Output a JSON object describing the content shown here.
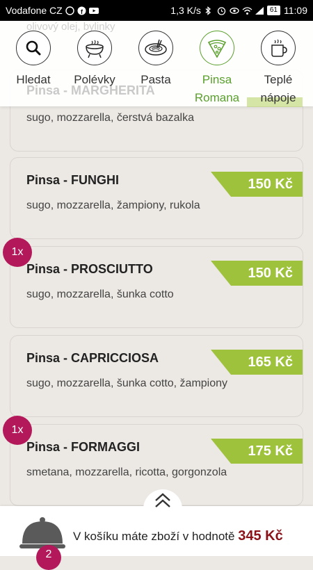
{
  "status_bar": {
    "carrier": "Vodafone CZ",
    "net_speed": "1,3 K/s",
    "battery": "61",
    "time": "11:09"
  },
  "categories_bar": {
    "behind_text": "olivový olej, bylinky",
    "behind_title": "Pinsa - MARGHERITA",
    "categories": [
      {
        "line1": "Hledat",
        "line2": "",
        "icon": "search-icon"
      },
      {
        "line1": "Polévky",
        "line2": "",
        "icon": "soup-pot-icon"
      },
      {
        "line1": "Pasta",
        "line2": "",
        "icon": "pasta-plate-icon"
      },
      {
        "line1": "Pinsa",
        "line2": "Romana",
        "icon": "pizza-slice-icon",
        "active": true
      },
      {
        "line1": "Teplé",
        "line2": "nápoje",
        "icon": "hot-drink-icon"
      }
    ]
  },
  "menu": {
    "items": [
      {
        "name": "",
        "desc": "sugo, mozzarella, čerstvá bazalka",
        "price": "",
        "qty": ""
      },
      {
        "name": "Pinsa - FUNGHI",
        "desc": "sugo, mozzarella, žampiony, rukola",
        "price": "150 Kč",
        "qty": ""
      },
      {
        "name": "Pinsa - PROSCIUTTO",
        "desc": "sugo, mozzarella, šunka cotto",
        "price": "150 Kč",
        "qty": "1x"
      },
      {
        "name": "Pinsa - CAPRICCIOSA",
        "desc": "sugo, mozzarella, šunka cotto, žampiony",
        "price": "165 Kč",
        "qty": ""
      },
      {
        "name": "Pinsa - FORMAGGI",
        "desc": "smetana, mozzarella, ricotta, gorgonzola",
        "price": "175 Kč",
        "qty": "1x"
      }
    ]
  },
  "cart": {
    "text": "V košíku máte zboží v hodnotě",
    "total": "345 Kč",
    "count": "2"
  },
  "colors": {
    "accent_green": "#9ec23c",
    "active_green": "#5aa02c",
    "badge_magenta": "#b3195a",
    "total_red": "#8a1219"
  }
}
